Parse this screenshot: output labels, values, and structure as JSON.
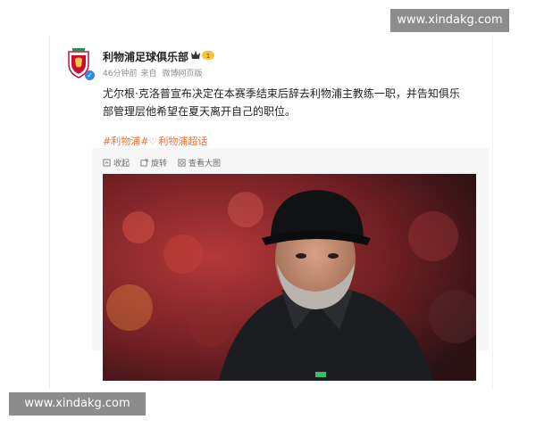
{
  "post": {
    "author": "利物浦足球俱乐部",
    "time": "46分钟前",
    "source_prefix": "来自",
    "source": "微博网页版",
    "text": "尤尔根·克洛普宣布决定在本赛季结束后辞去利物浦主教练一职，并告知俱乐部管理层他希望在夏天离开自己的职位。",
    "hashtag1": "#利物浦#",
    "hashtag2": "利物浦超话",
    "tools": {
      "collapse": "收起",
      "rotate": "旋转",
      "view_large": "查看大图"
    }
  },
  "watermark": {
    "top": "www.xindakg.com",
    "bottom": "www.xindakg.com"
  },
  "colors": {
    "accent": "#eb7340",
    "verify": "#2b8be6",
    "crest_red": "#c8102e"
  }
}
